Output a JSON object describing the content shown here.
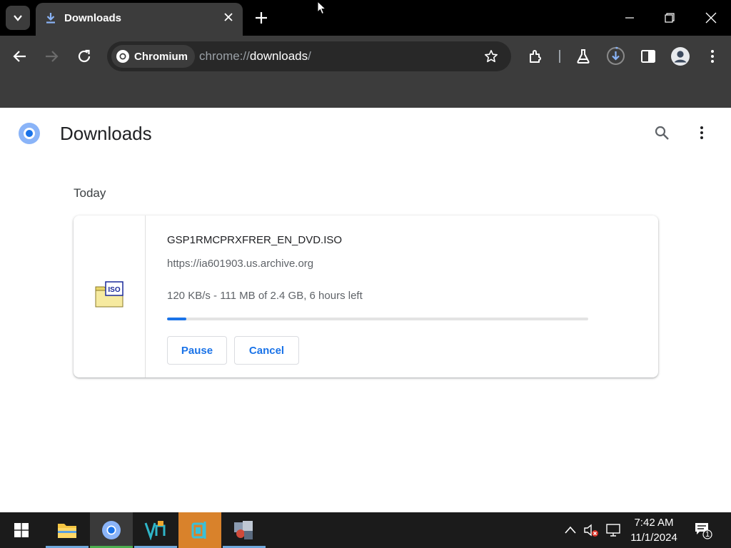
{
  "browser": {
    "tab": {
      "title": "Downloads"
    },
    "omnibox": {
      "chip_label": "Chromium",
      "url_scheme": "chrome://",
      "url_host": "downloads",
      "url_path": "/"
    }
  },
  "page": {
    "title": "Downloads",
    "section_label": "Today",
    "download": {
      "file_name": "GSP1RMCPRXFRER_EN_DVD.ISO",
      "source_url": "https://ia601903.us.archive.org",
      "status": "120 KB/s - 111 MB of 2.4 GB, 6 hours left",
      "progress_percent": 4.5,
      "file_type_label": "ISO",
      "pause_label": "Pause",
      "cancel_label": "Cancel"
    }
  },
  "taskbar": {
    "time": "7:42 AM",
    "date": "11/1/2024",
    "notification_count": "1"
  },
  "colors": {
    "accent": "#1a73e8",
    "tabstrip_bg": "#000000",
    "toolbar_bg": "#3c3c3c",
    "taskbar_bg": "#1b1b1b"
  }
}
